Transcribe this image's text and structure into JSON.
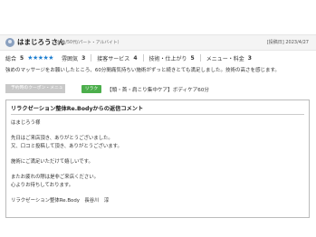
{
  "review": {
    "user_name": "はまじろうさん",
    "user_info": "（女性/50代/パート・アルバイト）",
    "posted_date": "[投稿日] 2023/4/27"
  },
  "ratings": {
    "overall_label": "総合",
    "overall_value": "5",
    "stars": "★★★★★",
    "items": [
      {
        "label": "雰囲気",
        "value": "3"
      },
      {
        "label": "接客サービス",
        "value": "4"
      },
      {
        "label": "技術・仕上がり",
        "value": "5"
      },
      {
        "label": "メニュー・料金",
        "value": "3"
      }
    ]
  },
  "comment_text": "強めのマッサージをお願いしたところ、60分間痛気持ちい施術がずっと続きとても満足しました。技術の高さを感じます。",
  "coupon": {
    "label": "予約時のクーポン・メニュー",
    "tag": "リラク",
    "menu": "【頭・首・肩こり集中ケア】ボディケア60分"
  },
  "reply": {
    "title": "リラクゼーション整体Re.Bodyからの返信コメント",
    "lines": [
      "はまじろう様",
      "先日はご来店頂き、ありがとうございました。",
      "又、口コミ投稿して頂き、ありがとうございます。",
      "施術にご満足いただけて嬉しいです。",
      "またお疲れの際は是非ご来店ください。",
      "心よりお待ちしております。",
      "リラクゼーション整体Re.Body　長谷川　淳"
    ]
  },
  "colors": {
    "star": "#1f7fd0",
    "tag_green": "#4cae4c",
    "coupon_gray": "#c9c9c9"
  }
}
